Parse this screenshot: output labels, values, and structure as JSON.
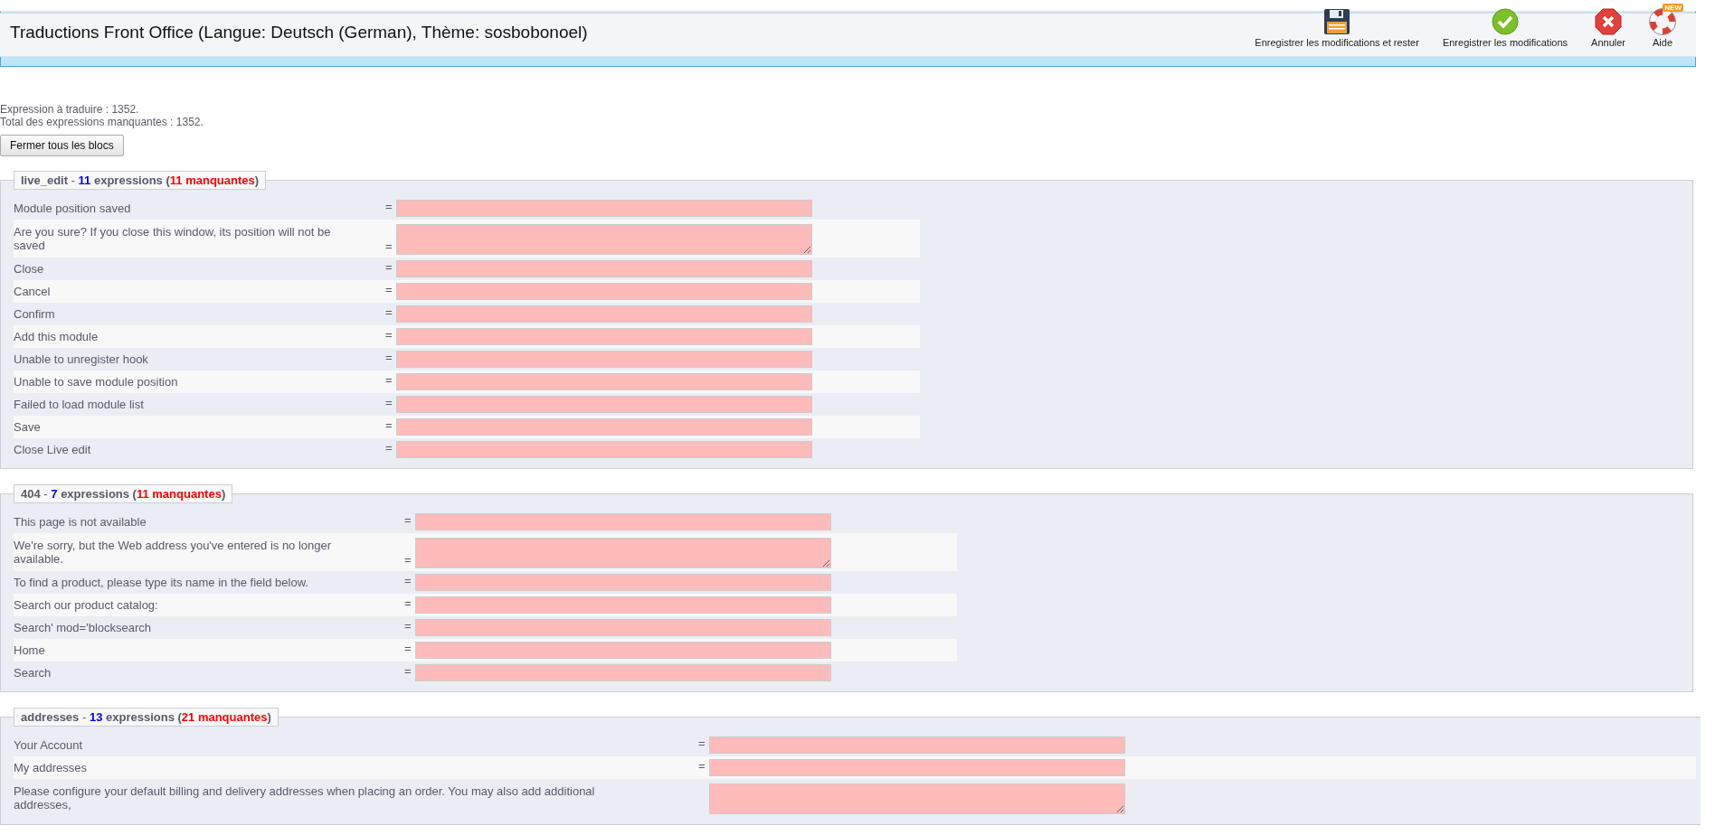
{
  "header": {
    "title": "Traductions Front Office (Langue: Deutsch (German), Thème: sosbobonoel)",
    "toolbar": [
      {
        "kind": "save-stay",
        "label": "Enregistrer les modifications et rester"
      },
      {
        "kind": "save",
        "label": "Enregistrer les modifications"
      },
      {
        "kind": "cancel",
        "label": "Annuler"
      },
      {
        "kind": "help",
        "label": "Aide",
        "badge": "NEW"
      }
    ]
  },
  "summary": [
    "Expression à traduire : 1352.",
    "Total des expressions manquantes : 1352."
  ],
  "collapse_button": "Fermer tous les blocs",
  "sections": [
    {
      "name": "live_edit",
      "sep": "-",
      "count": "11",
      "word": "expressions",
      "open": "(",
      "missing": "11 manquantes",
      "close": ")",
      "rows": [
        {
          "label": "Module position saved",
          "eq": "=",
          "kind": "input"
        },
        {
          "label": "Are you sure? If you close this window, its position will not be saved",
          "eq": "=",
          "kind": "textarea"
        },
        {
          "label": "Close",
          "eq": "=",
          "kind": "input"
        },
        {
          "label": "Cancel",
          "eq": "=",
          "kind": "input"
        },
        {
          "label": "Confirm",
          "eq": "=",
          "kind": "input"
        },
        {
          "label": "Add this module",
          "eq": "=",
          "kind": "input"
        },
        {
          "label": "Unable to unregister hook",
          "eq": "=",
          "kind": "input"
        },
        {
          "label": "Unable to save module position",
          "eq": "=",
          "kind": "input"
        },
        {
          "label": "Failed to load module list",
          "eq": "=",
          "kind": "input"
        },
        {
          "label": "Save",
          "eq": "=",
          "kind": "input"
        },
        {
          "label": "Close Live edit",
          "eq": "=",
          "kind": "input"
        }
      ]
    },
    {
      "name": "404",
      "sep": "-",
      "count": "7",
      "word": "expressions",
      "open": "(",
      "missing": "11 manquantes",
      "close": ")",
      "rows": [
        {
          "label": "This page is not available",
          "eq": "=",
          "kind": "input"
        },
        {
          "label": "We're sorry, but the Web address you've entered is no longer available.",
          "eq": "=",
          "kind": "textarea"
        },
        {
          "label": "To find a product, please type its name in the field below.",
          "eq": "=",
          "kind": "input"
        },
        {
          "label": "Search our product catalog:",
          "eq": "=",
          "kind": "input"
        },
        {
          "label": "Search' mod='blocksearch",
          "eq": "=",
          "kind": "input"
        },
        {
          "label": "Home",
          "eq": "=",
          "kind": "input"
        },
        {
          "label": "Search",
          "eq": "=",
          "kind": "input"
        }
      ]
    },
    {
      "name": "addresses",
      "sep": "-",
      "count": "13",
      "word": "expressions",
      "open": "(",
      "missing": "21 manquantes",
      "close": ")",
      "rows": [
        {
          "label": "Your Account",
          "eq": "=",
          "kind": "input"
        },
        {
          "label": "My addresses",
          "eq": "=",
          "kind": "input"
        },
        {
          "label": "Please configure your default billing and delivery addresses when placing an order. You may also add additional addresses,",
          "kind": "textarea"
        }
      ]
    }
  ]
}
